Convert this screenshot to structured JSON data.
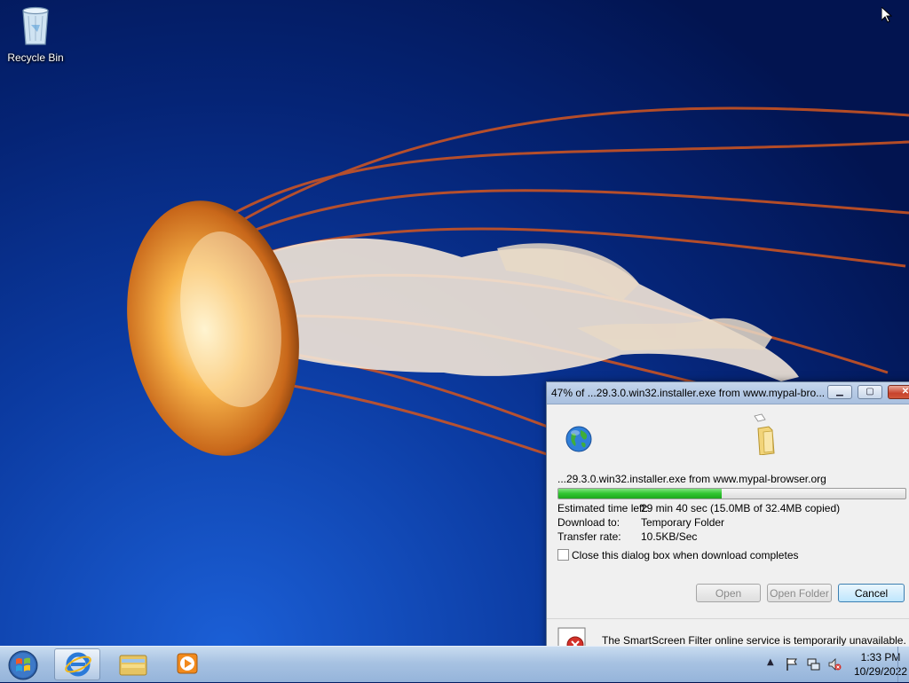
{
  "desktop": {
    "recycle_bin_label": "Recycle Bin"
  },
  "dialog": {
    "title": "47% of ...29.3.0.win32.installer.exe from www.mypal-bro...",
    "file_source": "...29.3.0.win32.installer.exe from www.mypal-browser.org",
    "progress_percent": 47,
    "estimated_time_label": "Estimated time left:",
    "estimated_time_value": "29 min 40 sec (15.0MB of 32.4MB copied)",
    "download_to_label": "Download to:",
    "download_to_value": "Temporary Folder",
    "transfer_rate_label": "Transfer rate:",
    "transfer_rate_value": "10.5KB/Sec",
    "close_checkbox_label": "Close this dialog box when download completes",
    "close_checkbox_checked": false,
    "buttons": {
      "open": "Open",
      "open_folder": "Open Folder",
      "cancel": "Cancel"
    },
    "smartscreen_message": "The SmartScreen Filter online service is temporarily unavailable."
  },
  "taskbar": {
    "pinned": [
      {
        "name": "internet-explorer-icon"
      },
      {
        "name": "windows-explorer-icon"
      },
      {
        "name": "windows-media-player-icon"
      }
    ],
    "clock_time": "1:33 PM",
    "clock_date": "10/29/2022"
  },
  "colors": {
    "progress_fill": "#30c530",
    "desktop_blue": "#0b3aa0"
  }
}
